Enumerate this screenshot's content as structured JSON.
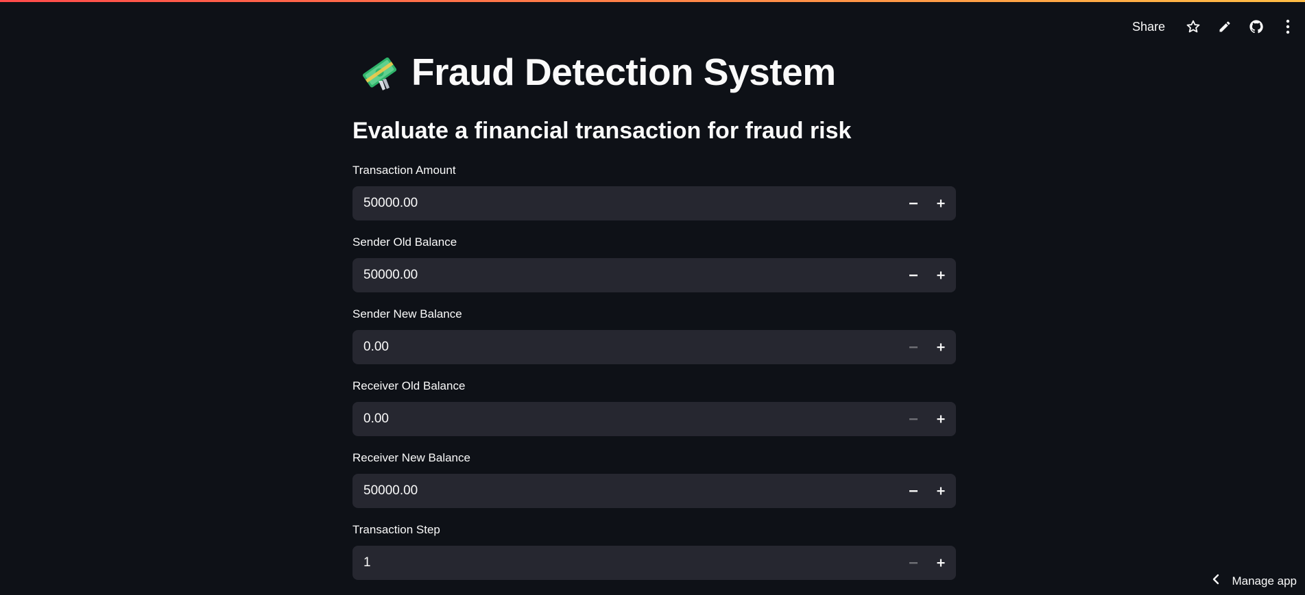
{
  "header": {
    "share_label": "Share",
    "icons": [
      "star-icon",
      "pencil-icon",
      "github-icon",
      "kebab-menu-icon"
    ]
  },
  "page": {
    "title_icon": "money-with-wings-icon",
    "title": "Fraud Detection System",
    "subtitle": "Evaluate a financial transaction for fraud risk"
  },
  "fields": [
    {
      "label": "Transaction Amount",
      "value": "50000.00",
      "minus_enabled": true
    },
    {
      "label": "Sender Old Balance",
      "value": "50000.00",
      "minus_enabled": true
    },
    {
      "label": "Sender New Balance",
      "value": "0.00",
      "minus_enabled": false
    },
    {
      "label": "Receiver Old Balance",
      "value": "0.00",
      "minus_enabled": false
    },
    {
      "label": "Receiver New Balance",
      "value": "50000.00",
      "minus_enabled": true
    },
    {
      "label": "Transaction Step",
      "value": "1",
      "minus_enabled": false
    }
  ],
  "footer": {
    "manage_app_label": "Manage app"
  },
  "colors": {
    "background": "#0e1117",
    "input_background": "#262730",
    "text": "#fafafa",
    "accent_gradient_start": "#ff4b4b",
    "accent_gradient_end": "#ffbd45"
  }
}
